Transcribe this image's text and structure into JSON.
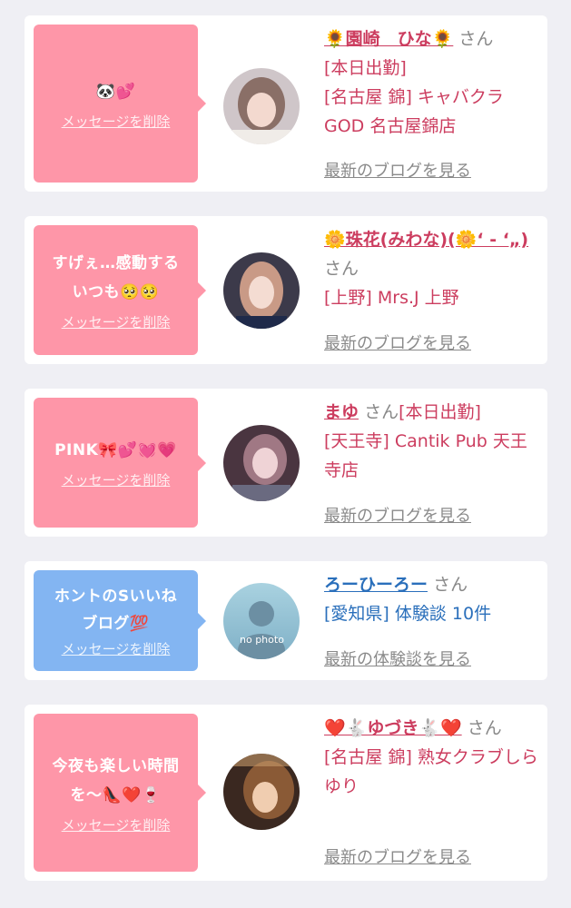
{
  "cards": [
    {
      "message": "🐼💕",
      "delete_label": "メッセージを削除",
      "name": "🌻園崎　ひな🌻",
      "honorific": "さん",
      "detail": "[本日出勤]\n[名古屋 錦] キャバクラGOD 名古屋錦店",
      "link": "最新のブログを見る",
      "bubble_color": "#fe96a8",
      "avatar": "photo"
    },
    {
      "message": "すげぇ…感動する\nいつも🥺🥺",
      "delete_label": "メッセージを削除",
      "name": "🌼珠花(みわな)(🌼‘ - ‘„)",
      "honorific": "さん",
      "detail": "[上野] Mrs.J 上野",
      "link": "最新のブログを見る",
      "bubble_color": "#fe96a8",
      "avatar": "photo"
    },
    {
      "message": "PINK🎀💕💓💗",
      "delete_label": "メッセージを削除",
      "name": "まゆ",
      "honorific": "さん",
      "detail": "[本日出勤]\n[天王寺] Cantik Pub 天王寺店",
      "link": "最新のブログを見る",
      "bubble_color": "#fe96a8",
      "avatar": "photo"
    },
    {
      "message": "ホントのSいいね\nブログ💯",
      "delete_label": "メッセージを削除",
      "name": "ろーひーろー",
      "honorific": "さん",
      "detail": "[愛知県] 体験談 10件",
      "link": "最新の体験談を見る",
      "bubble_color": "#83b5f2",
      "avatar": "no photo"
    },
    {
      "message": "今夜も楽しい時間\nを〜👠❤️🍷",
      "delete_label": "メッセージを削除",
      "name": "❤️🐇ゆづき🐇❤️",
      "honorific": "さん",
      "detail": "[名古屋 錦] 熟女クラブしらゆり",
      "link": "最新のブログを見る",
      "bubble_color": "#fe96a8",
      "avatar": "photo"
    }
  ]
}
